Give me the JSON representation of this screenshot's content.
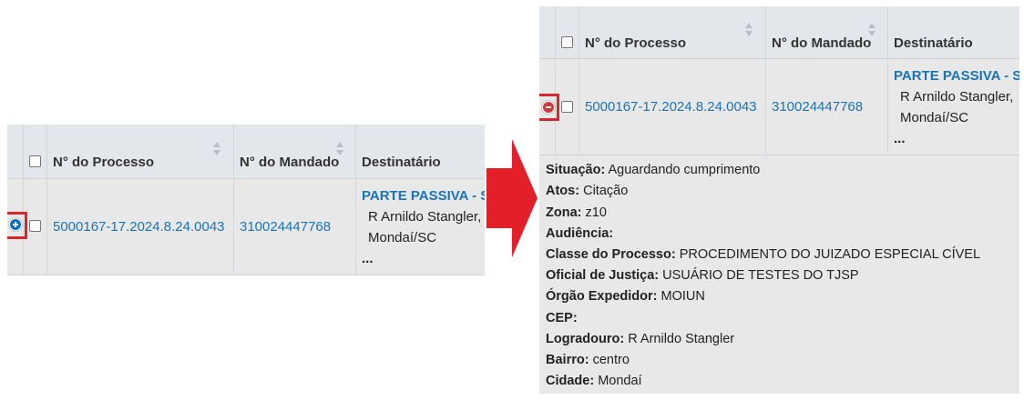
{
  "columns": {
    "processo": "N° do Processo",
    "mandado": "N° do Mandado",
    "destinatario": "Destinatário"
  },
  "row": {
    "processo": "5000167-17.2024.8.24.0043",
    "mandado": "310024447768",
    "destinatario_title": "PARTE PASSIVA - S",
    "destinatario_line1": "R Arnildo Stangler,",
    "destinatario_line2": "Mondaí/SC",
    "destinatario_more": "..."
  },
  "details": [
    {
      "label": "Situação:",
      "value": "Aguardando cumprimento"
    },
    {
      "label": "Atos:",
      "value": "Citação"
    },
    {
      "label": "Zona:",
      "value": "z10"
    },
    {
      "label": "Audiência:",
      "value": ""
    },
    {
      "label": "Classe do Processo:",
      "value": "PROCEDIMENTO DO JUIZADO ESPECIAL CÍVEL"
    },
    {
      "label": "Oficial de Justiça:",
      "value": "USUÁRIO DE TESTES DO TJSP"
    },
    {
      "label": "Órgão Expedidor:",
      "value": "MOIUN"
    },
    {
      "label": "CEP:",
      "value": ""
    },
    {
      "label": "Logradouro:",
      "value": "R Arnildo Stangler"
    },
    {
      "label": "Bairro:",
      "value": "centro"
    },
    {
      "label": "Cidade:",
      "value": "Mondaí"
    }
  ],
  "colors": {
    "link": "#1b74b8",
    "highlight": "#d9252e",
    "expand_plus": "#0b6fc2",
    "expand_minus": "#cf3a3f",
    "arrow": "#e3202a"
  },
  "icons": {
    "expand": "plus-circle-icon",
    "collapse": "minus-circle-icon",
    "transition": "right-arrow-icon"
  }
}
